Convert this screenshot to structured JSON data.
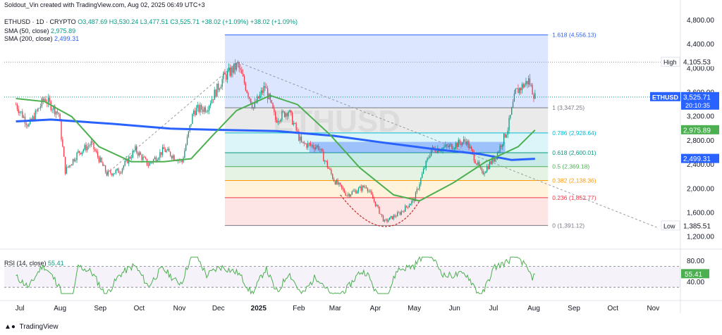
{
  "header": {
    "credit": "Soldout_Vin created with TradingView.com, Aug 02, 2025 06:49 UTC+3",
    "symbol_line": "ETHUSD · 1D · CRYPTO",
    "ohlc": "O3,487.69  H3,530.24  L3,477.51  C3,525.71  +38.02 (+1.09%)  +38.02 (+1.09%)",
    "sma50_label": "SMA (50, close)",
    "sma50_value": "2,975.89",
    "sma200_label": "SMA (200, close)",
    "sma200_value": "2,499.31",
    "rsi_label": "RSI (14, close)",
    "rsi_value": "55.41"
  },
  "watermark": "ETHUSD",
  "footer_logo": "TradingView",
  "colors": {
    "up": "#089981",
    "down": "#f23645",
    "sma50": "#4caf50",
    "sma200": "#2962ff",
    "rsi": "#4caf50",
    "price_tag": "#2962ff",
    "sma50_tag": "#4caf50"
  },
  "chart_data": {
    "type": "candlestick",
    "x_ticks": [
      "Jul",
      "Aug",
      "Sep",
      "Oct",
      "Nov",
      "Dec",
      "2025",
      "Feb",
      "Mar",
      "Apr",
      "May",
      "Jun",
      "Jul",
      "Aug",
      "Sep",
      "Oct",
      "Nov"
    ],
    "y_ticks": [
      "4,800.00",
      "4,400.00",
      "4,000.00",
      "3,600.00",
      "3,200.00",
      "2,800.00",
      "2,400.00",
      "2,000.00",
      "1,600.00",
      "1,200.00"
    ],
    "ylim": [
      1150,
      4950
    ],
    "price_path": [
      [
        "2024-06-28",
        3400
      ],
      [
        "2024-07-08",
        3050
      ],
      [
        "2024-07-20",
        3500
      ],
      [
        "2024-07-31",
        3250
      ],
      [
        "2024-08-05",
        2300
      ],
      [
        "2024-08-15",
        2600
      ],
      [
        "2024-08-25",
        2750
      ],
      [
        "2024-09-06",
        2250
      ],
      [
        "2024-09-16",
        2300
      ],
      [
        "2024-09-28",
        2650
      ],
      [
        "2024-10-08",
        2400
      ],
      [
        "2024-10-20",
        2650
      ],
      [
        "2024-11-03",
        2450
      ],
      [
        "2024-11-12",
        3300
      ],
      [
        "2024-11-22",
        3350
      ],
      [
        "2024-12-05",
        3850
      ],
      [
        "2024-12-16",
        4050
      ],
      [
        "2024-12-28",
        3350
      ],
      [
        "2025-01-06",
        3700
      ],
      [
        "2025-01-14",
        3150
      ],
      [
        "2025-01-24",
        3300
      ],
      [
        "2025-02-03",
        2750
      ],
      [
        "2025-02-16",
        2700
      ],
      [
        "2025-02-28",
        2150
      ],
      [
        "2025-03-10",
        1900
      ],
      [
        "2025-03-25",
        2050
      ],
      [
        "2025-04-08",
        1450
      ],
      [
        "2025-04-20",
        1600
      ],
      [
        "2025-05-01",
        1830
      ],
      [
        "2025-05-08",
        2300
      ],
      [
        "2025-05-14",
        2650
      ],
      [
        "2025-05-28",
        2700
      ],
      [
        "2025-06-10",
        2800
      ],
      [
        "2025-06-22",
        2250
      ],
      [
        "2025-07-03",
        2550
      ],
      [
        "2025-07-12",
        3000
      ],
      [
        "2025-07-18",
        3600
      ],
      [
        "2025-07-28",
        3800
      ],
      [
        "2025-08-02",
        3525.71
      ]
    ],
    "sma50_path": [
      [
        "2024-06-28",
        3500
      ],
      [
        "2024-07-20",
        3450
      ],
      [
        "2024-08-10",
        3200
      ],
      [
        "2024-08-31",
        2700
      ],
      [
        "2024-09-25",
        2450
      ],
      [
        "2024-10-20",
        2450
      ],
      [
        "2024-11-10",
        2500
      ],
      [
        "2024-11-25",
        2850
      ],
      [
        "2024-12-15",
        3300
      ],
      [
        "2025-01-10",
        3550
      ],
      [
        "2025-01-31",
        3400
      ],
      [
        "2025-02-25",
        2900
      ],
      [
        "2025-03-20",
        2350
      ],
      [
        "2025-04-15",
        1900
      ],
      [
        "2025-05-05",
        1800
      ],
      [
        "2025-05-31",
        2100
      ],
      [
        "2025-06-25",
        2450
      ],
      [
        "2025-07-20",
        2700
      ],
      [
        "2025-08-02",
        2975.89
      ]
    ],
    "sma200_path": [
      [
        "2024-06-28",
        3120
      ],
      [
        "2024-07-25",
        3150
      ],
      [
        "2024-09-10",
        3080
      ],
      [
        "2024-10-25",
        3000
      ],
      [
        "2024-12-01",
        2980
      ],
      [
        "2025-01-15",
        2960
      ],
      [
        "2025-02-28",
        2880
      ],
      [
        "2025-04-10",
        2760
      ],
      [
        "2025-05-20",
        2650
      ],
      [
        "2025-06-20",
        2580
      ],
      [
        "2025-07-15",
        2480
      ],
      [
        "2025-08-02",
        2499.31
      ]
    ],
    "rsi": {
      "ylim": [
        10,
        95
      ],
      "ticks": [
        "80.00",
        "40.00"
      ],
      "band": [
        30,
        70
      ],
      "last": 55.41
    },
    "fib_levels": [
      {
        "ratio": "1.618",
        "price": 4556.13,
        "label": "1.618 (4,556.13)",
        "color": "#2962ff"
      },
      {
        "ratio": "1",
        "price": 3347.25,
        "label": "1 (3,347.25)",
        "color": "#787b86"
      },
      {
        "ratio": "0.786",
        "price": 2928.64,
        "label": "0.786 (2,928.64)",
        "color": "#00bcd4"
      },
      {
        "ratio": "0.618",
        "price": 2600.01,
        "label": "0.618 (2,600.01)",
        "color": "#089981"
      },
      {
        "ratio": "0.5",
        "price": 2369.18,
        "label": "0.5 (2,369.18)",
        "color": "#4caf50"
      },
      {
        "ratio": "0.382",
        "price": 2138.36,
        "label": "0.382 (2,138.36)",
        "color": "#ff9800"
      },
      {
        "ratio": "0.236",
        "price": 1852.77,
        "label": "0.236 (1,852.77)",
        "color": "#f23645"
      },
      {
        "ratio": "0",
        "price": 1391.12,
        "label": "0 (1,391.12)",
        "color": "#787b86"
      }
    ],
    "price_tags": [
      {
        "label": "High",
        "value": "4,105.53",
        "price": 4105.53
      },
      {
        "label": "ETHUSD",
        "value": "3,525.71",
        "sub": "20:10:35",
        "price": 3525.71
      },
      {
        "label": "",
        "value": "2,975.89",
        "price": 2975.89
      },
      {
        "label": "",
        "value": "2,499.31",
        "price": 2499.31
      },
      {
        "label": "Low",
        "value": "1,385.51",
        "price": 1385.51
      }
    ],
    "rsi_tag": "55.41"
  }
}
